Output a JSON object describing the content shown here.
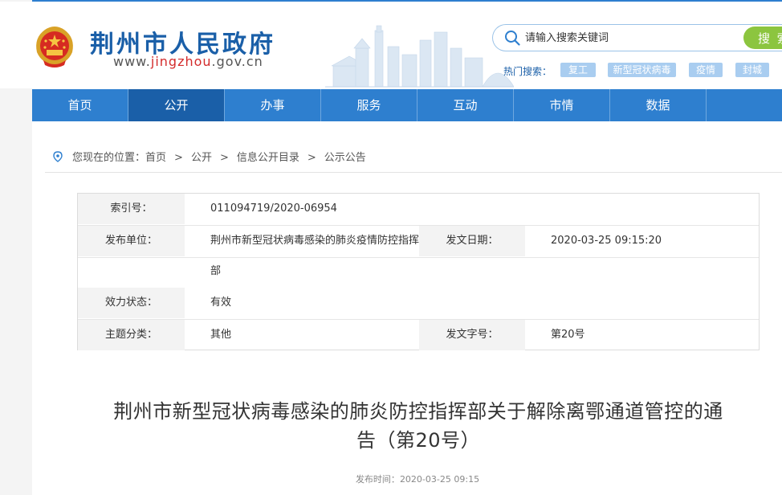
{
  "header": {
    "site_name": "荆州市人民政府",
    "site_url_prefix": "www.",
    "site_url_highlight": "jingzhou",
    "site_url_suffix": ".gov.cn"
  },
  "search": {
    "placeholder": "请输入搜索关键词",
    "button_label": "搜 索",
    "hot_label": "热门搜索：",
    "hot_tags": [
      "复工",
      "新型冠状病毒",
      "疫情",
      "封城"
    ]
  },
  "nav": {
    "items": [
      "首页",
      "公开",
      "办事",
      "服务",
      "互动",
      "市情",
      "数据"
    ],
    "active_index": 1
  },
  "breadcrumb": {
    "prefix": "您现在的位置：",
    "items": [
      "首页",
      "公开",
      "信息公开目录",
      "公示公告"
    ],
    "separator": ">"
  },
  "info": {
    "index_label": "索引号：",
    "index_value": "011094719/2020-06954",
    "publisher_label": "发布单位：",
    "publisher_value_line1": "荆州市新型冠状病毒感染的肺炎疫情防控指挥",
    "publisher_value_line2": "部",
    "issue_date_label": "发文日期：",
    "issue_date_value": "2020-03-25 09:15:20",
    "status_label": "效力状态：",
    "status_value": "有效",
    "topic_label": "主题分类：",
    "topic_value": "其他",
    "doc_no_label": "发文字号：",
    "doc_no_value": "第20号"
  },
  "article": {
    "title_line1": "荆州市新型冠状病毒感染的肺炎防控指挥部关于解除离鄂通道管控的通",
    "title_line2": "告（第20号）",
    "meta_label": "发布时间：",
    "meta_value": "2020-03-25 09:15"
  },
  "colors": {
    "nav_bg": "#2e7fcf",
    "nav_active": "#1a5fa8",
    "search_button": "#8cc53f",
    "hot_tag": "#a9cdf0",
    "url_highlight": "#d32b2b"
  }
}
